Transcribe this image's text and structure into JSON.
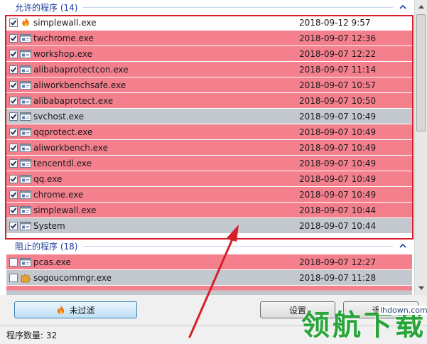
{
  "allowed_group": {
    "title": "允许的程序 (14)",
    "rows": [
      {
        "name": "simplewall.exe",
        "date": "2018-09-12 9:57",
        "color": "white",
        "icon": "flame-icon",
        "checked": true
      },
      {
        "name": "twchrome.exe",
        "date": "2018-09-07 12:36",
        "color": "pink",
        "icon": "app-window-icon",
        "checked": true
      },
      {
        "name": "workshop.exe",
        "date": "2018-09-07 12:22",
        "color": "pink",
        "icon": "app-window-icon",
        "checked": true
      },
      {
        "name": "alibabaprotectcon.exe",
        "date": "2018-09-07 11:14",
        "color": "pink",
        "icon": "app-window-icon",
        "checked": true
      },
      {
        "name": "aliworkbenchsafe.exe",
        "date": "2018-09-07 10:57",
        "color": "pink",
        "icon": "app-window-icon",
        "checked": true
      },
      {
        "name": "alibabaprotect.exe",
        "date": "2018-09-07 10:50",
        "color": "pink",
        "icon": "app-window-icon",
        "checked": true
      },
      {
        "name": "svchost.exe",
        "date": "2018-09-07 10:49",
        "color": "gray",
        "icon": "app-window-icon",
        "checked": true
      },
      {
        "name": "qqprotect.exe",
        "date": "2018-09-07 10:49",
        "color": "pink",
        "icon": "app-window-icon",
        "checked": true
      },
      {
        "name": "aliworkbench.exe",
        "date": "2018-09-07 10:49",
        "color": "pink",
        "icon": "app-window-icon",
        "checked": true
      },
      {
        "name": "tencentdl.exe",
        "date": "2018-09-07 10:49",
        "color": "pink",
        "icon": "app-window-icon",
        "checked": true
      },
      {
        "name": "qq.exe",
        "date": "2018-09-07 10:49",
        "color": "pink",
        "icon": "app-window-icon",
        "checked": true
      },
      {
        "name": "chrome.exe",
        "date": "2018-09-07 10:49",
        "color": "pink",
        "icon": "app-window-icon",
        "checked": true
      },
      {
        "name": "simplewall.exe",
        "date": "2018-09-07 10:44",
        "color": "pink",
        "icon": "app-window-icon",
        "checked": true
      },
      {
        "name": "System",
        "date": "2018-09-07 10:44",
        "color": "gray",
        "icon": "app-window-icon",
        "checked": true
      }
    ]
  },
  "blocked_group": {
    "title": "阻止的程序 (18)",
    "rows": [
      {
        "name": "pcas.exe",
        "date": "2018-09-07 12:27",
        "color": "pink",
        "icon": "app-window-icon",
        "checked": false
      },
      {
        "name": "sogoucommgr.exe",
        "date": "2018-09-07 11:28",
        "color": "gray",
        "icon": "puzzle-icon",
        "checked": false
      }
    ]
  },
  "buttons": {
    "filter_label": "未过滤",
    "settings_label": "设置",
    "exit_label": "退出"
  },
  "status": {
    "count_text": "程序数量: 32"
  },
  "watermark": {
    "text": "领航下载",
    "url": "lhdown.com"
  },
  "colors": {
    "pink": "#f4808e",
    "gray": "#c3c8cf",
    "highlight_border": "#d81e26",
    "group_title": "#1e3d9c"
  }
}
